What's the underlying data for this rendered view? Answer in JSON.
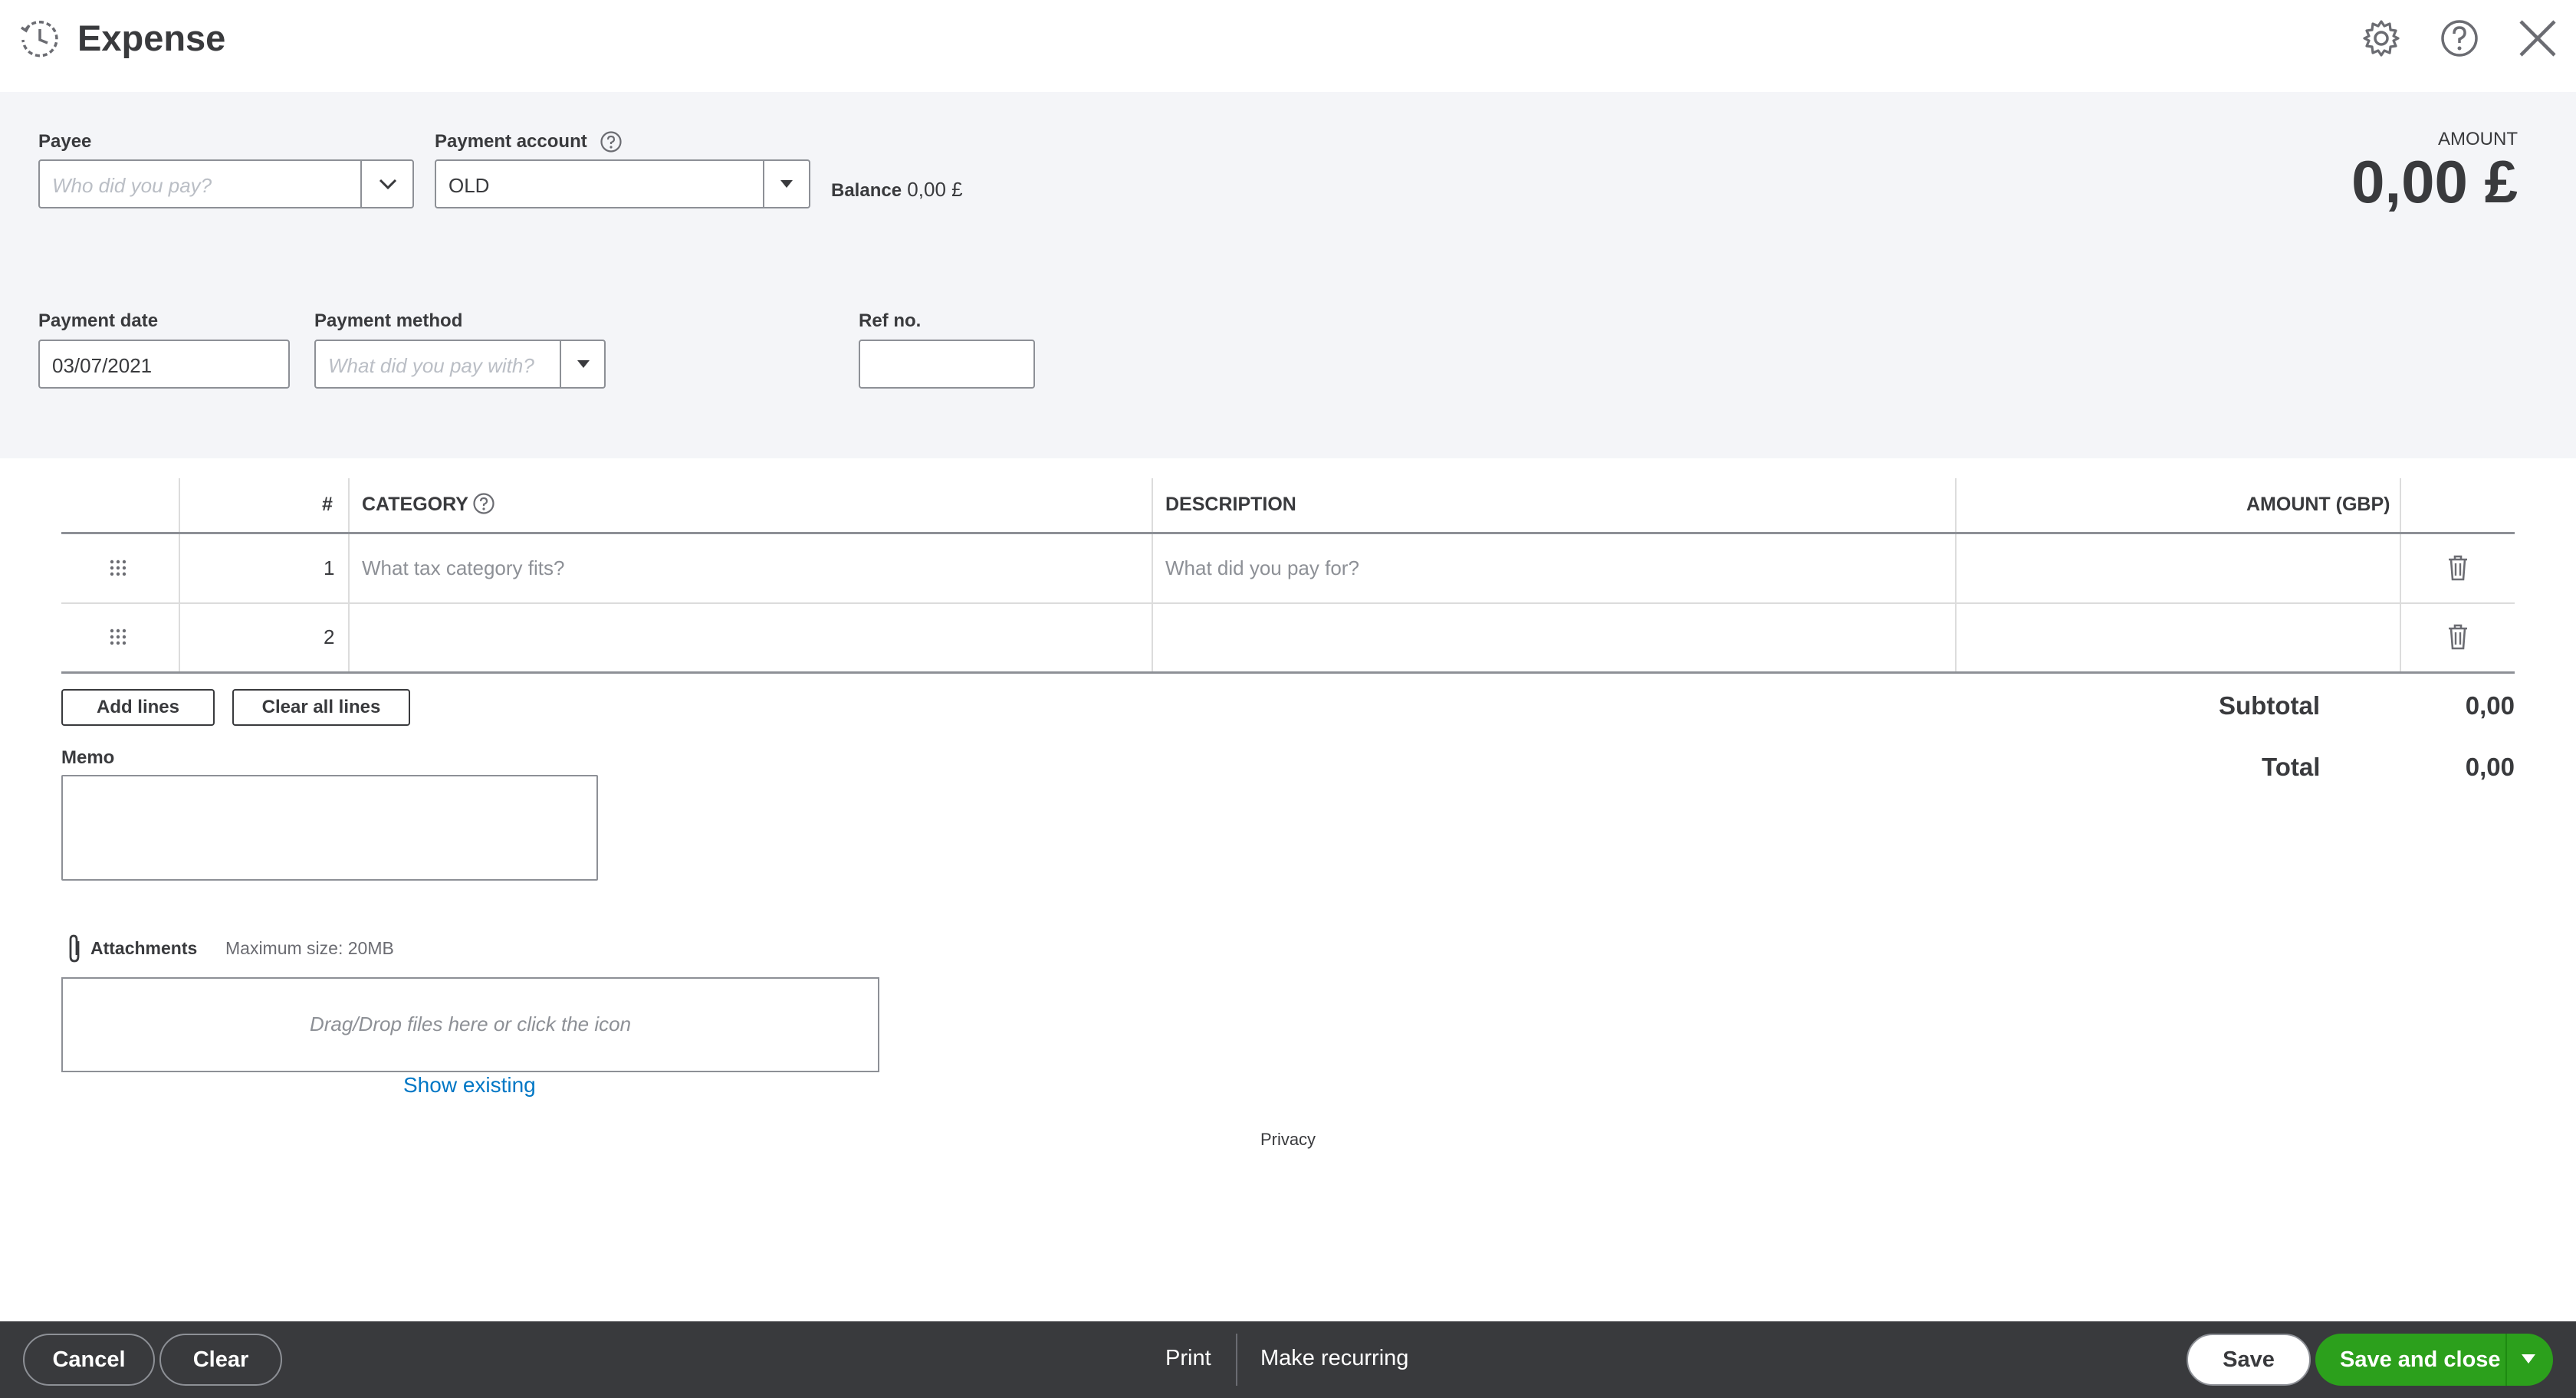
{
  "header": {
    "title": "Expense",
    "icons": [
      "recent-transactions-icon",
      "settings-gear-icon",
      "help-icon",
      "close-icon"
    ]
  },
  "form": {
    "payee": {
      "label": "Payee",
      "placeholder": "Who did you pay?",
      "value": ""
    },
    "payment_account": {
      "label": "Payment account",
      "value": "OLD"
    },
    "balance": {
      "label": "Balance",
      "value": "0,00 £"
    },
    "amount": {
      "label": "AMOUNT",
      "value": "0,00 £"
    },
    "payment_date": {
      "label": "Payment date",
      "value": "03/07/2021"
    },
    "payment_method": {
      "label": "Payment method",
      "placeholder": "What did you pay with?",
      "value": ""
    },
    "ref_no": {
      "label": "Ref no.",
      "value": ""
    }
  },
  "table": {
    "columns": {
      "num": "#",
      "category": "CATEGORY",
      "description": "DESCRIPTION",
      "amount": "AMOUNT (GBP)"
    },
    "rows": [
      {
        "num": "1",
        "category_placeholder": "What tax category fits?",
        "description_placeholder": "What did you pay for?",
        "amount": ""
      },
      {
        "num": "2",
        "category_placeholder": "",
        "description_placeholder": "",
        "amount": ""
      }
    ]
  },
  "actions": {
    "add_lines": "Add lines",
    "clear_all_lines": "Clear all lines"
  },
  "totals": {
    "subtotal_label": "Subtotal",
    "subtotal_value": "0,00",
    "total_label": "Total",
    "total_value": "0,00"
  },
  "memo": {
    "label": "Memo",
    "value": ""
  },
  "attachments": {
    "label": "Attachments",
    "max_size": "Maximum size: 20MB",
    "drop_hint": "Drag/Drop files here or click the icon",
    "show_existing": "Show existing"
  },
  "privacy": "Privacy",
  "footer": {
    "cancel": "Cancel",
    "clear": "Clear",
    "print": "Print",
    "make_recurring": "Make recurring",
    "save": "Save",
    "save_and_close": "Save and close"
  },
  "colors": {
    "primary_green": "#2ca01c",
    "footer_bg": "#393a3d",
    "link_blue": "#0077c5",
    "form_bg": "#f4f5f8"
  }
}
